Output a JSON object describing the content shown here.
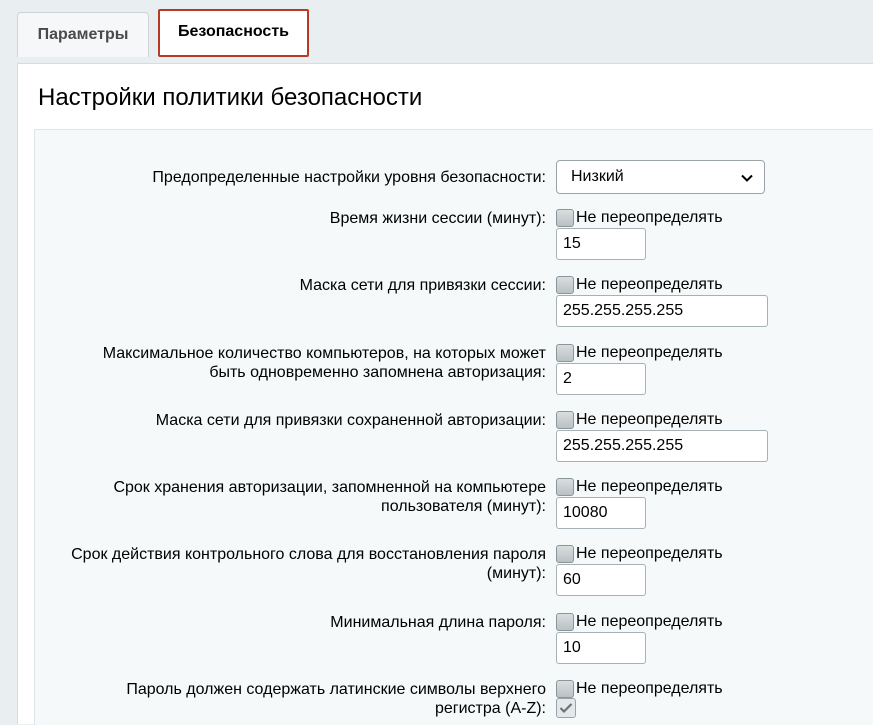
{
  "tabs": [
    {
      "label": "Параметры"
    },
    {
      "label": "Безопасность"
    }
  ],
  "title": "Настройки политики безопасности",
  "preset": {
    "label": "Предопределенные настройки уровня безопасности:",
    "value": "Низкий"
  },
  "override_text": "Не переопределять",
  "fields": [
    {
      "label": "Время жизни сессии (минут):",
      "value": "15"
    },
    {
      "label": "Маска сети для привязки сессии:",
      "value": "255.255.255.255"
    },
    {
      "label_lines": [
        "Максимальное количество компьютеров, на которых может",
        "быть одновременно запомнена авторизация:"
      ],
      "value": "2"
    },
    {
      "label": "Маска сети для привязки сохраненной авторизации:",
      "value": "255.255.255.255"
    },
    {
      "label_lines": [
        "Срок хранения авторизации, запомненной на компьютере",
        "пользователя (минут):"
      ],
      "value": "10080"
    },
    {
      "label_lines": [
        "Срок действия контрольного слова для восстановления пароля",
        "(минут):"
      ],
      "value": "60"
    },
    {
      "label": "Минимальная длина пароля:",
      "value": "10"
    },
    {
      "label_lines": [
        "Пароль должен содержать латинские символы верхнего",
        "регистра (A-Z):"
      ],
      "checked": true
    }
  ]
}
